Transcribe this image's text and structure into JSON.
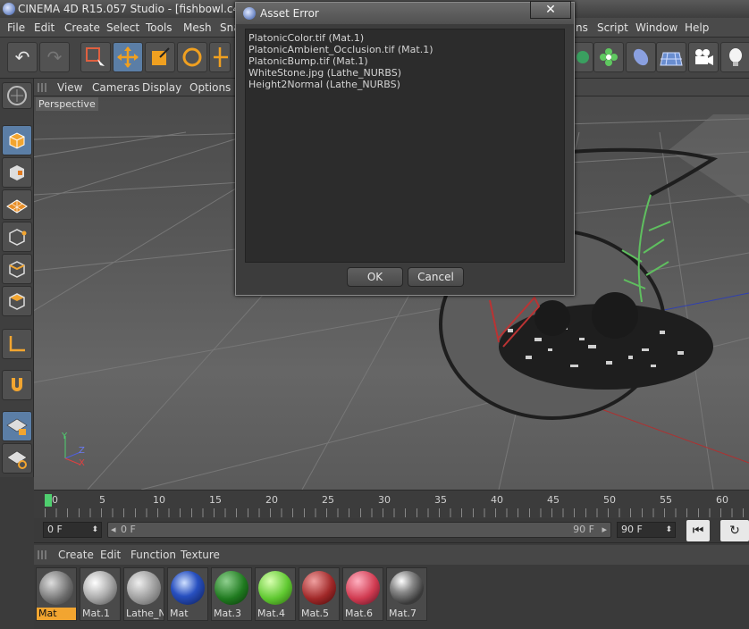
{
  "window": {
    "title": "CINEMA 4D R15.057 Studio - [fishbowl.c4d *"
  },
  "menu": [
    "File",
    "Edit",
    "Create",
    "Select",
    "Tools",
    "Mesh",
    "Sna",
    "ns",
    "Script",
    "Window",
    "Help"
  ],
  "viewport_menu": [
    "View",
    "Cameras",
    "Display",
    "Options"
  ],
  "viewport": {
    "label": "Perspective",
    "axes": {
      "x": "X",
      "y": "Y",
      "z": "Z"
    }
  },
  "timeline": {
    "ticks": [
      "0",
      "5",
      "10",
      "15",
      "20",
      "25",
      "30",
      "35",
      "40",
      "45",
      "50",
      "55",
      "60"
    ]
  },
  "transport": {
    "current_frame": "0 F",
    "range_start": "0 F",
    "range_end": "90 F",
    "end_frame": "90 F"
  },
  "material_menu": [
    "Create",
    "Edit",
    "Function",
    "Texture"
  ],
  "materials": [
    {
      "name": "Mat"
    },
    {
      "name": "Mat.1"
    },
    {
      "name": "Lathe_N"
    },
    {
      "name": "Mat"
    },
    {
      "name": "Mat.3"
    },
    {
      "name": "Mat.4"
    },
    {
      "name": "Mat.5"
    },
    {
      "name": "Mat.6"
    },
    {
      "name": "Mat.7"
    }
  ],
  "dialog": {
    "title": "Asset Error",
    "close": "✕",
    "items": [
      "PlatonicColor.tif (Mat.1)",
      "PlatonicAmbient_Occlusion.tif (Mat.1)",
      "PlatonicBump.tif (Mat.1)",
      "WhiteStone.jpg (Lathe_NURBS)",
      "Height2Normal (Lathe_NURBS)"
    ],
    "ok": "OK",
    "cancel": "Cancel"
  },
  "colors": {
    "accent": "#5b7ea6",
    "selected_material": "#f2a530",
    "timeline_marker": "#4fcf6f"
  }
}
